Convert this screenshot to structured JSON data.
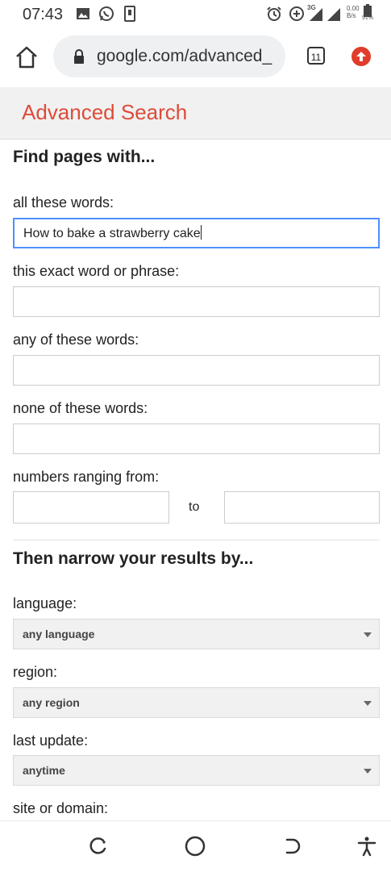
{
  "status_bar": {
    "time": "07:43",
    "network": "3G",
    "speed_value": "0.00",
    "speed_unit": "B/s",
    "battery": "91%"
  },
  "browser": {
    "url": "google.com/advanced_",
    "tab_count": "11"
  },
  "page": {
    "title": "Advanced Search",
    "section1_heading": "Find pages with...",
    "fields": {
      "all_words_label": "all these words:",
      "all_words_value": "How to bake a strawberry cake",
      "exact_label": "this exact word or phrase:",
      "exact_value": "",
      "any_label": "any of these words:",
      "any_value": "",
      "none_label": "none of these words:",
      "none_value": "",
      "numbers_label": "numbers ranging from:",
      "numbers_to": "to"
    },
    "section2_heading": "Then narrow your results by...",
    "filters": {
      "language_label": "language:",
      "language_value": "any language",
      "region_label": "region:",
      "region_value": "any region",
      "update_label": "last update:",
      "update_value": "anytime",
      "site_label": "site or domain:"
    }
  },
  "icons": [
    "image-icon",
    "whatsapp-icon",
    "phone-icon",
    "alarm-icon",
    "data-saver-icon",
    "signal-icon",
    "battery-icon",
    "home-icon",
    "lock-icon",
    "tabs-icon",
    "update-icon",
    "recents-icon",
    "home-circle-icon",
    "back-icon",
    "accessibility-icon"
  ],
  "colors": {
    "title_red": "#dd4b39",
    "focus_blue": "#4d90fe",
    "update_red": "#e03c2c"
  }
}
